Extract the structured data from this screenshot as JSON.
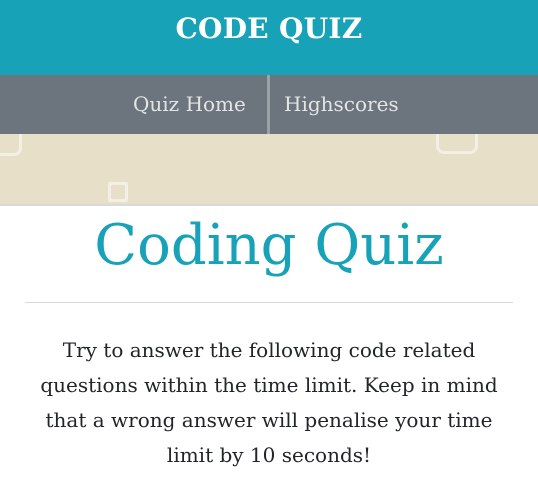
{
  "header": {
    "brand": "CODE QUIZ"
  },
  "nav": {
    "items": [
      {
        "label": "Quiz Home"
      },
      {
        "label": "Highscores"
      }
    ]
  },
  "main": {
    "title": "Coding Quiz",
    "intro": "Try to answer the following code related questions within the time limit. Keep in mind that a wrong answer will penalise your time limit by 10 seconds!"
  },
  "colors": {
    "header_bg": "#17a2b8",
    "nav_bg": "#6c757d",
    "pattern_bg": "#e8dfc8",
    "title": "#17a2b8"
  }
}
